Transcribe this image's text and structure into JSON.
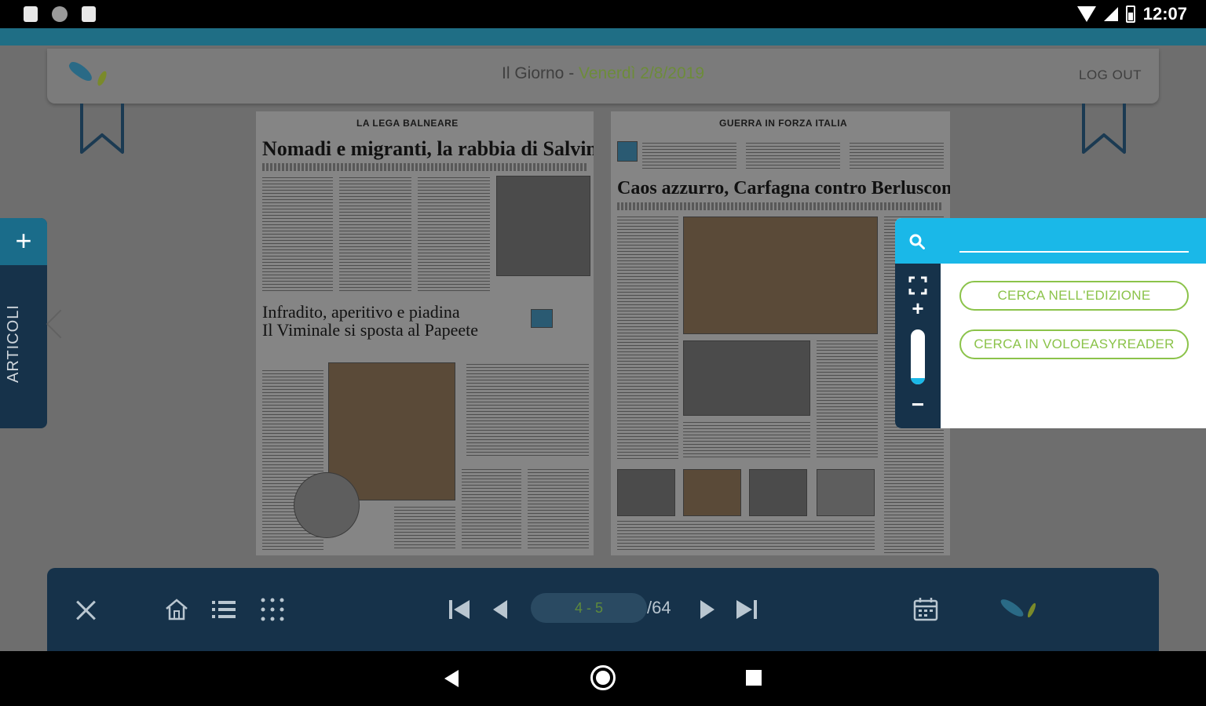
{
  "statusbar": {
    "time": "12:07"
  },
  "header": {
    "title": "Il Giorno",
    "separator": " - ",
    "date": "Venerdì 2/8/2019",
    "logout_label": "LOG OUT"
  },
  "sidebar": {
    "add_label": "+",
    "tab_label": "ARTICOLI"
  },
  "newspaper": {
    "left_kicker": "LA LEGA BALNEARE",
    "left_headline": "Nomadi e migranti, la rabbia di Salvini",
    "left_headline2_line1": "Infradito, aperitivo e piadina",
    "left_headline2_line2": "Il Viminale si sposta al Papeete",
    "right_kicker": "GUERRA IN FORZA ITALIA",
    "right_headline": "Caos azzurro, Carfagna contro Berlusconi"
  },
  "search": {
    "input_value": "",
    "btn_edition": "CERCA NELL'EDIZIONE",
    "btn_reader": "CERCA IN VOLOEASYREADER",
    "zoom_plus": "+",
    "zoom_minus": "−",
    "zoom_level": 0.12
  },
  "toolbar": {
    "page_range": "4 - 5",
    "page_total": "/64"
  },
  "colors": {
    "accent": "#1ab8e8",
    "green": "#8bc34a",
    "navy": "#16324a"
  }
}
